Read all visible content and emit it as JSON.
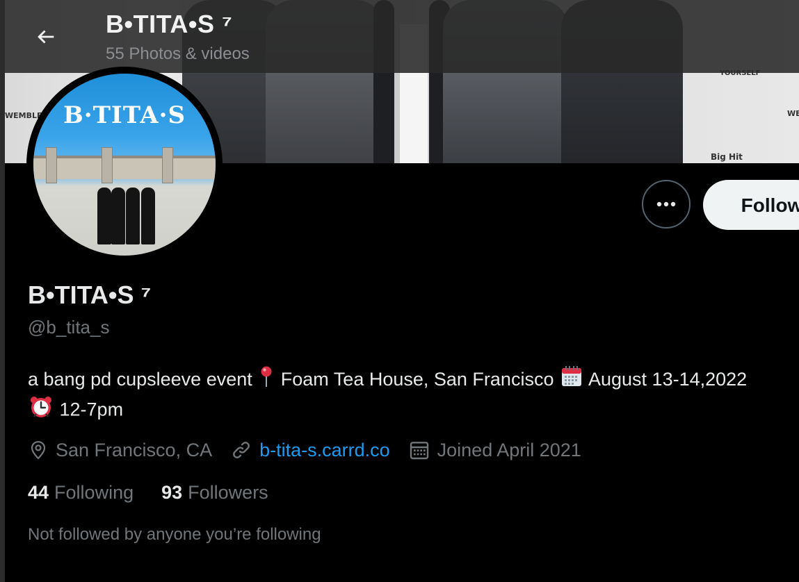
{
  "header": {
    "title": "B•TITA•S ⁷",
    "subtitle": "55 Photos & videos"
  },
  "banner": {
    "wall_text_left": "WEMBLEY",
    "wall_text_right": "WE",
    "wall_text_top": "YOURSELF",
    "wall_text_brand": "Big Hit"
  },
  "avatar": {
    "logo_text": "B·TITA·S"
  },
  "actions": {
    "follow_label": "Follow"
  },
  "profile": {
    "display_name": "B•TITA•S ⁷",
    "handle": "@b_tita_s",
    "bio_part1": "a bang pd cupsleeve event",
    "bio_part2": "Foam Tea House, San Francisco",
    "bio_part3": "August 13-14,2022",
    "bio_part4": "12-7pm",
    "location": "San Francisco, CA",
    "website": "b-tita-s.carrd.co",
    "joined": "Joined April 2021"
  },
  "stats": {
    "following_count": "44",
    "following_label": "Following",
    "followers_count": "93",
    "followers_label": "Followers"
  },
  "followed_note": "Not followed by anyone you’re following",
  "colors": {
    "background": "#000000",
    "text_primary": "#e7e9ea",
    "text_secondary": "#71767b",
    "link": "#1d9bf0",
    "follow_button_bg": "#eff3f4"
  },
  "icons": {
    "back": "arrow-left-icon",
    "more": "more-dots-icon",
    "location": "location-pin-icon",
    "link": "link-icon",
    "calendar": "calendar-icon",
    "bio_pin": "round-pushpin-emoji",
    "bio_calendar": "calendar-emoji",
    "bio_alarm": "alarm-clock-emoji"
  }
}
